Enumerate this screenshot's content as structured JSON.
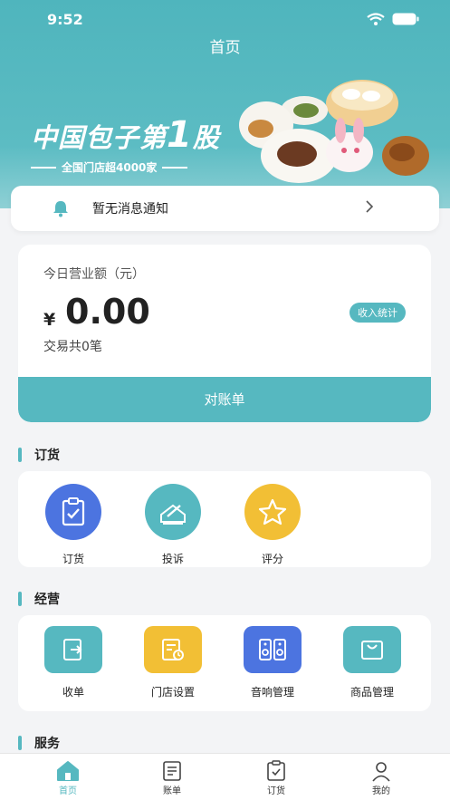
{
  "status_bar": {
    "time": "9:52"
  },
  "nav": {
    "title": "首页"
  },
  "banner": {
    "title_prefix": "中国包子第",
    "title_number": "1",
    "title_suffix": "股",
    "subtitle": "全国门店超4000家"
  },
  "notice": {
    "text": "暂无消息通知"
  },
  "revenue": {
    "label": "今日营业额（元）",
    "currency": "¥",
    "amount": "0.00",
    "count_text": "交易共0笔",
    "stats_button": "收入统计",
    "reconcile_button": "对账单"
  },
  "sections": {
    "order": {
      "title": "订货",
      "items": [
        {
          "label": "订货",
          "icon": "clipboard-check-icon",
          "color": "#4c74e0"
        },
        {
          "label": "投诉",
          "icon": "pen-envelope-icon",
          "color": "#56b8c0"
        },
        {
          "label": "评分",
          "icon": "star-icon",
          "color": "#f2bf35"
        }
      ]
    },
    "ops": {
      "title": "经营",
      "items": [
        {
          "label": "收单",
          "icon": "receipt-icon",
          "color": "#56b8c0"
        },
        {
          "label": "门店设置",
          "icon": "store-settings-icon",
          "color": "#f2bf35"
        },
        {
          "label": "音响管理",
          "icon": "speaker-icon",
          "color": "#4c74e0"
        },
        {
          "label": "商品管理",
          "icon": "bag-icon",
          "color": "#56b8c0"
        }
      ]
    },
    "service": {
      "title": "服务"
    }
  },
  "tabbar": [
    {
      "label": "首页",
      "icon": "home-icon"
    },
    {
      "label": "账单",
      "icon": "document-icon"
    },
    {
      "label": "订货",
      "icon": "clipboard-icon"
    },
    {
      "label": "我的",
      "icon": "user-icon"
    }
  ]
}
